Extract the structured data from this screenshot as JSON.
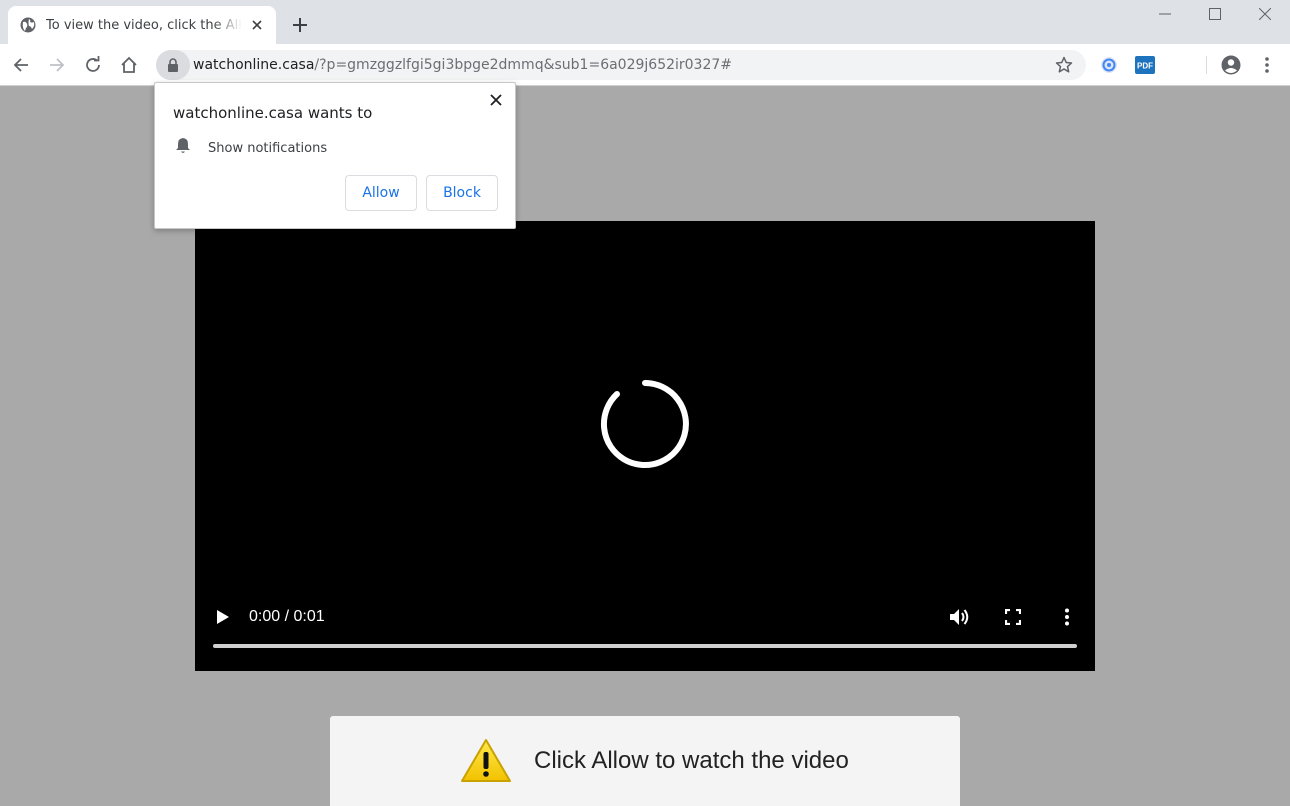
{
  "browser": {
    "tab_title": "To view the video, click the Allow button",
    "url_host": "watchonline.casa",
    "url_path": "/?p=gmzggzlfgi5gi3bpge2dmmq&sub1=6a029j652ir0327#",
    "extensions": [
      "blue-circle-extension-icon",
      "pdf-extension-icon"
    ],
    "pdf_ext_label": "PDF"
  },
  "popup": {
    "title": "watchonline.casa wants to",
    "permission": "Show notifications",
    "allow_label": "Allow",
    "block_label": "Block"
  },
  "video": {
    "time": "0:00 / 0:01",
    "progress": 0
  },
  "banner": {
    "text": "Click Allow to watch the video"
  },
  "colors": {
    "page_bg": "#a9a9a9",
    "link_blue": "#1a73e8",
    "warning_yellow": "#f5d400"
  }
}
